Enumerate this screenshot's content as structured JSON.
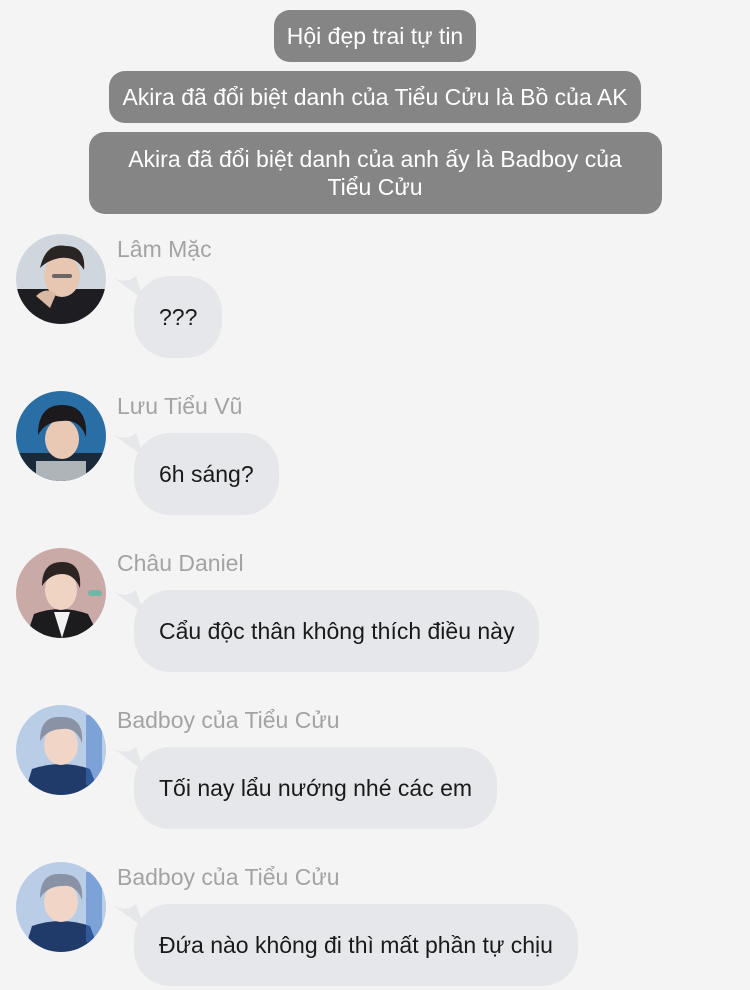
{
  "system_notices": [
    "Hội đẹp trai tự tin",
    "Akira đã đổi biệt danh của Tiểu Cửu là Bồ của AK",
    "Akira đã đổi biệt danh của anh ấy là Badboy của Tiểu Cửu"
  ],
  "messages": [
    {
      "sender": "Lâm Mặc",
      "text": "???"
    },
    {
      "sender": "Lưu Tiểu Vũ",
      "text": "6h sáng?"
    },
    {
      "sender": "Châu Daniel",
      "text": "Cẩu độc thân không thích điều này"
    },
    {
      "sender": "Badboy của Tiểu Cửu",
      "text": "Tối nay lẩu nướng nhé các em"
    },
    {
      "sender": "Badboy của Tiểu Cửu",
      "text": "Đứa nào không đi thì mất phần tự chịu"
    }
  ],
  "colors": {
    "background": "#f4f4f4",
    "system_bubble": "#858585",
    "message_bubble": "#e5e7ea",
    "sender_name": "#a3a3a3"
  }
}
